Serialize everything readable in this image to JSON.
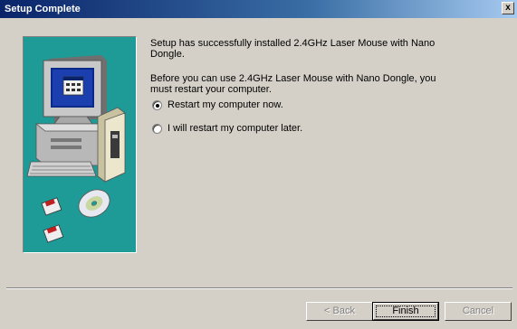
{
  "window": {
    "title": "Setup Complete",
    "close_label": "x"
  },
  "content": {
    "message": "Setup has successfully installed 2.4GHz Laser Mouse with Nano Dongle.",
    "restart_prompt": "Before you can use 2.4GHz Laser Mouse with Nano Dongle, you must restart your computer.",
    "options": [
      {
        "label": "Restart my computer now.",
        "selected": true
      },
      {
        "label": "I will restart my computer later.",
        "selected": false
      }
    ]
  },
  "buttons": {
    "back": "< Back",
    "finish": "Finish",
    "cancel": "Cancel"
  },
  "colors": {
    "title_bar_start": "#0a246a",
    "title_bar_end": "#a6caf0",
    "art_background": "#1e9a97",
    "dialog": "#d4d0c8"
  },
  "icons": {
    "art": "computer-with-disks-illustration"
  }
}
